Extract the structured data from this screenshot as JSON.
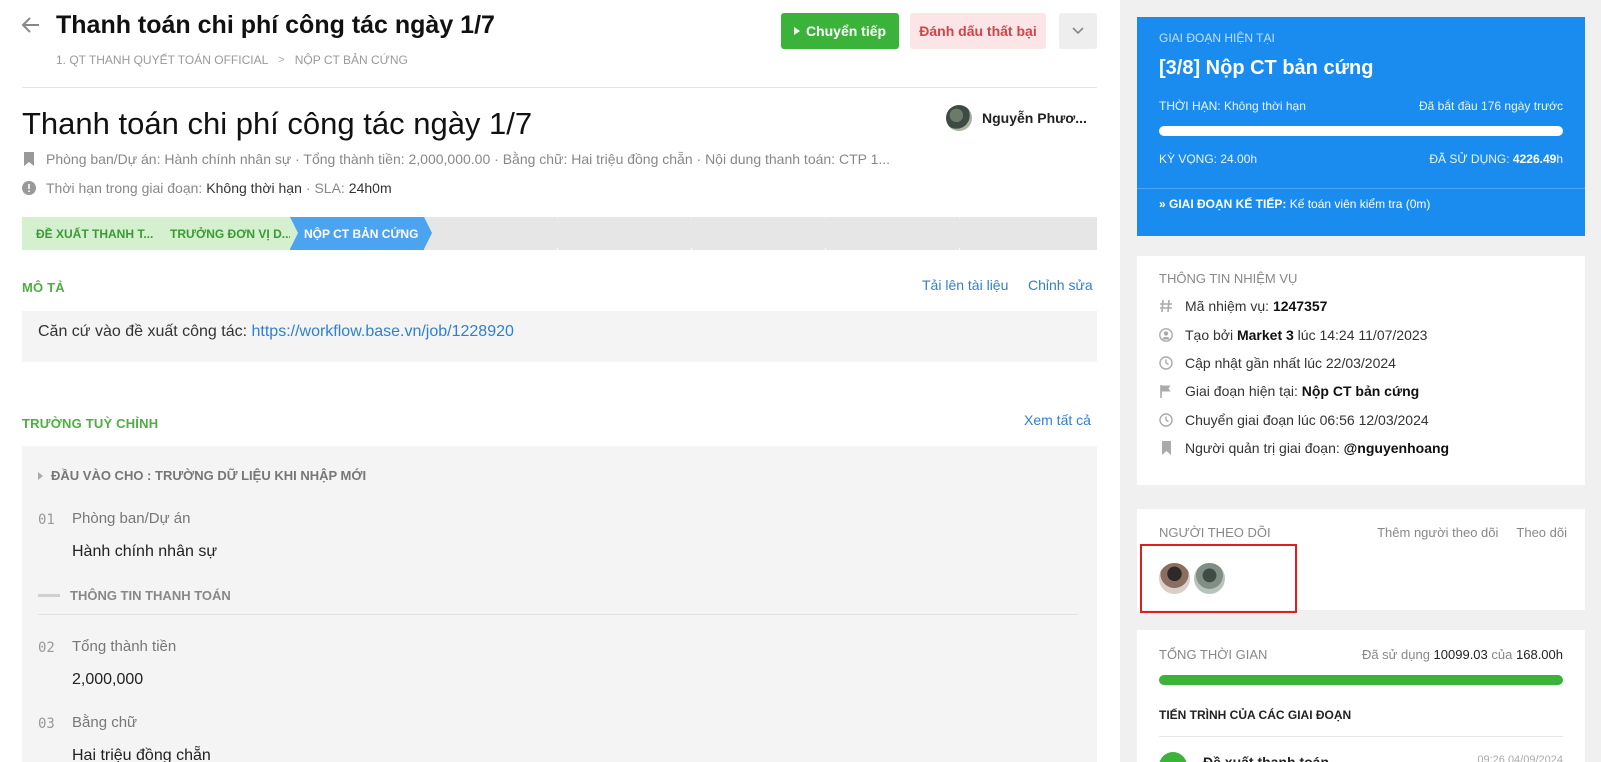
{
  "header": {
    "title": "Thanh toán chi phí công tác ngày 1/7",
    "breadcrumb": [
      "1. QT THANH QUYẾT TOÁN OFFICIAL",
      "NỘP CT BẢN CỨNG"
    ],
    "breadcrumb_sep": ">",
    "forward_label": "Chuyển tiếp",
    "fail_label": "Đánh dấu thất bại"
  },
  "task": {
    "title": "Thanh toán chi phí công tác ngày 1/7",
    "owner_name": "Nguyễn Phươ...",
    "meta_summary": "Phòng ban/Dự án: Hành chính nhân sự · Tổng thành tiền: 2,000,000.00 · Bằng chữ: Hai triệu đồng chẵn · Nội dung thanh toán: CTP 1...",
    "deadline_label": "Thời hạn trong giai đoạn:",
    "deadline_value": "Không thời hạn",
    "sla_label": "· SLA:",
    "sla_value": "24h0m"
  },
  "stages": [
    {
      "label": "ĐỀ XUẤT THANH T...",
      "state": "done"
    },
    {
      "label": "TRƯỞNG ĐƠN VỊ D...",
      "state": "done"
    },
    {
      "label": "NỘP CT BẢN CỨNG",
      "state": "current"
    },
    {
      "label": "",
      "state": "todo"
    },
    {
      "label": "",
      "state": "todo"
    },
    {
      "label": "",
      "state": "todo"
    },
    {
      "label": "",
      "state": "todo"
    },
    {
      "label": "",
      "state": "todo"
    }
  ],
  "description": {
    "section_label": "MÔ TẢ",
    "upload_label": "Tải lên tài liệu",
    "edit_label": "Chỉnh sửa",
    "text": "Căn cứ vào đề xuất công tác: ",
    "link": "https://workflow.base.vn/job/1228920"
  },
  "custom_fields": {
    "section_label": "TRƯỜNG TUỲ CHỈNH",
    "view_all_label": "Xem tất cả",
    "group_label": "ĐẦU VÀO CHO : TRƯỜNG DỮ LIỆU KHI NHẬP MỚI",
    "subgroup_label": "THÔNG TIN THANH TOÁN",
    "items": [
      {
        "num": "01",
        "label": "Phòng ban/Dự án",
        "value": "Hành chính nhân sự"
      },
      {
        "num": "02",
        "label": "Tổng thành tiền",
        "value": "2,000,000"
      },
      {
        "num": "03",
        "label": "Bằng chữ",
        "value": "Hai triệu đồng chẵn"
      }
    ]
  },
  "stage_card": {
    "label": "GIAI ĐOẠN HIỆN TẠI",
    "title": "[3/8] Nộp CT bản cứng",
    "deadline_label": "THỜI HẠN:",
    "deadline_value": "Không thời hạn",
    "started": "Đã bắt đầu 176 ngày trước",
    "expected_label": "KỲ VỌNG:",
    "expected_value": "24.00h",
    "used_label": "ĐÃ SỬ DỤNG:",
    "used_value": "4226.49",
    "used_unit": "h",
    "next_label": "» GIAI ĐOẠN KẾ TIẾP:",
    "next_value": "Kế toán viên kiểm tra (0m)"
  },
  "info_card": {
    "label": "THÔNG TIN NHIỆM VỤ",
    "rows": [
      {
        "prefix": "Mã nhiệm vụ: ",
        "bold": "1247357",
        "suffix": ""
      },
      {
        "prefix": "Tạo bởi ",
        "bold": "Market 3",
        "suffix": " lúc 14:24 11/07/2023"
      },
      {
        "prefix": "Cập nhật gần nhất lúc 22/03/2024",
        "bold": "",
        "suffix": ""
      },
      {
        "prefix": "Giai đoạn hiện tại: ",
        "bold": "Nộp CT bản cứng",
        "suffix": ""
      },
      {
        "prefix": "Chuyển giai đoạn lúc 06:56 12/03/2024",
        "bold": "",
        "suffix": ""
      },
      {
        "prefix": "Người quản trị giai đoạn: ",
        "bold": "@nguyenhoang",
        "suffix": ""
      }
    ]
  },
  "followers_card": {
    "label": "NGƯỜI THEO DÕI",
    "add_label": "Thêm người theo dõi",
    "follow_label": "Theo dõi"
  },
  "time_card": {
    "label": "TỔNG THỜI GIAN",
    "used_prefix": "Đã sử dụng",
    "used_value": "10099.03",
    "of_label": "của",
    "total_value": "168.00h",
    "progress_label": "TIẾN TRÌNH CỦA CÁC GIAI ĐOẠN",
    "first_stage_name": "Đề xuất thanh toán",
    "first_stage_date": "09:26 04/09/2024"
  }
}
